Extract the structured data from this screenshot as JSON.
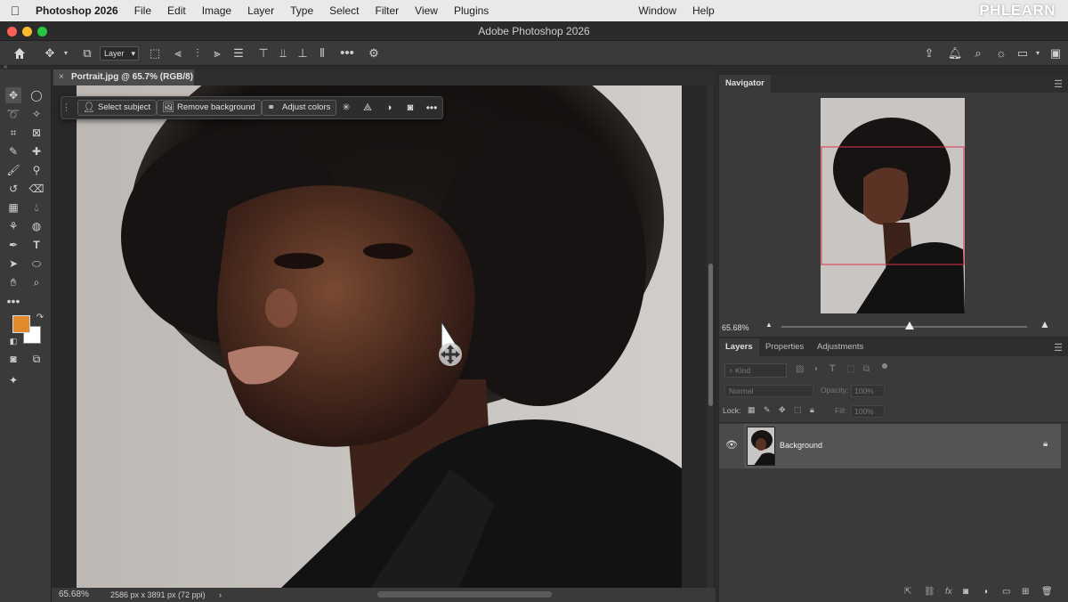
{
  "menubar": {
    "app_name": "Photoshop 2026",
    "items": [
      "File",
      "Edit",
      "Image",
      "Layer",
      "Type",
      "Select",
      "Filter",
      "View",
      "Plugins"
    ],
    "right_items": [
      "Window",
      "Help"
    ],
    "watermark": "PHLEARN"
  },
  "window": {
    "title": "Adobe Photoshop 2026"
  },
  "options_bar": {
    "layer_select": "Layer"
  },
  "document": {
    "tab_title": "Portrait.jpg @ 65.7% (RGB/8)",
    "zoom": "65.68%",
    "dimensions": "2586 px x 3891 px (72 ppi)",
    "status_arrow": "›"
  },
  "context_bar": {
    "select_subject": "Select subject",
    "remove_background": "Remove background",
    "adjust_colors": "Adjust colors"
  },
  "navigator": {
    "tab": "Navigator",
    "zoom": "65.68%",
    "zoom_slider_level": 0.52
  },
  "layers_panel": {
    "tabs": [
      "Layers",
      "Properties",
      "Adjustments"
    ],
    "filter_kind": "Kind",
    "blend_mode": "Normal",
    "opacity_label": "Opacity:",
    "opacity_value": "100%",
    "lock_label": "Lock:",
    "fill_label": "Fill:",
    "fill_value": "100%",
    "layers": [
      {
        "name": "Background",
        "visible": true,
        "locked": true
      }
    ]
  },
  "colors": {
    "foreground": "#e08a2c",
    "background": "#ffffff",
    "navigator_frame": "#e0304a"
  }
}
